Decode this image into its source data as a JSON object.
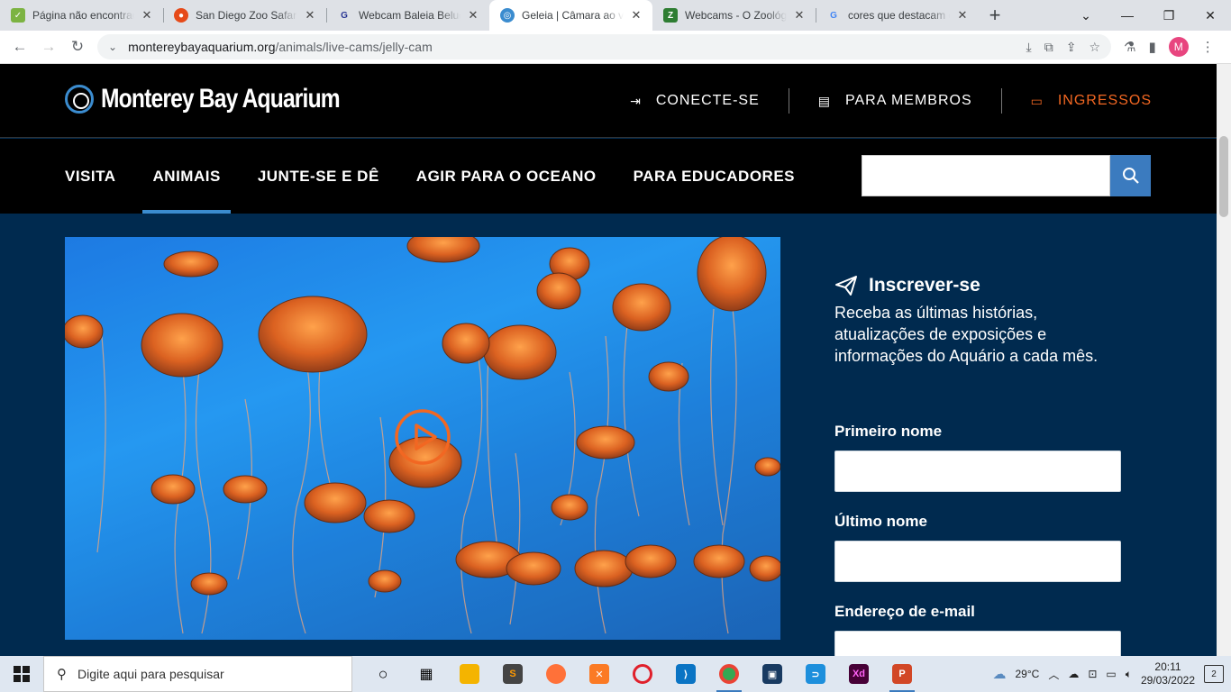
{
  "browser": {
    "tabs": [
      {
        "title": "Página não encontrada",
        "favicon_color": "#7cb342",
        "favicon_glyph": "✓"
      },
      {
        "title": "San Diego Zoo Safari Park",
        "favicon_color": "#e64a19",
        "favicon_glyph": "●"
      },
      {
        "title": "Webcam Baleia Beluga",
        "favicon_color": "#283593",
        "favicon_glyph": "G"
      },
      {
        "title": "Geleia | Câmara ao vivo",
        "favicon_color": "#3b8ccf",
        "favicon_glyph": "◎"
      },
      {
        "title": "Webcams - O Zoológico",
        "favicon_color": "#2e7d32",
        "favicon_glyph": "Z"
      },
      {
        "title": "cores que destacam o",
        "favicon_color": "#4285f4",
        "favicon_glyph": "G"
      }
    ],
    "active_tab": 3,
    "url_host": "montereybayaquarium.org",
    "url_path": "/animals/live-cams/jelly-cam",
    "profile_initial": "M"
  },
  "site": {
    "logo_text": "Monterey Bay Aquarium",
    "utility": {
      "signin": "CONECTE-SE",
      "members": "PARA MEMBROS",
      "tickets": "INGRESSOS"
    },
    "nav": [
      "VISITA",
      "ANIMAIS",
      "JUNTE-SE E DÊ",
      "AGIR PARA O OCEANO",
      "PARA EDUCADORES"
    ],
    "active_nav": "ANIMAIS",
    "search_placeholder": ""
  },
  "signup": {
    "title": "Inscrever-se",
    "description": "Receba as últimas histórias, atualizações de exposições e informações do Aquário a cada mês.",
    "first_name_label": "Primeiro nome",
    "last_name_label": "Último nome",
    "email_label": "Endereço de e-mail"
  },
  "taskbar": {
    "search_placeholder": "Digite aqui para pesquisar",
    "weather": "29°C",
    "time": "20:11",
    "date": "29/03/2022",
    "notifications": "2"
  },
  "colors": {
    "page_bg": "#002a4f",
    "accent_blue": "#3b8ccf",
    "tickets_orange": "#f26722"
  }
}
